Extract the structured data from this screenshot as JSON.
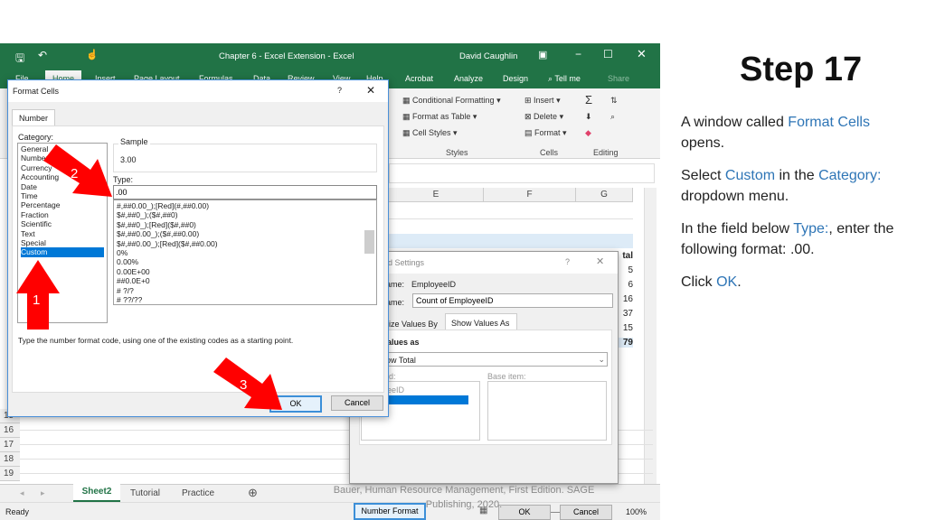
{
  "slide": {
    "title": "Step 17",
    "p1": {
      "a": "A window called ",
      "b": "Format Cells",
      "c": " opens."
    },
    "p2": {
      "a": "Select ",
      "b": "Custom",
      "c": " in the ",
      "d": "Category:",
      "e": " dropdown menu."
    },
    "p3": {
      "a": "In the field below ",
      "b": "Type:",
      "c": ", enter the following format: .00."
    },
    "p4": {
      "a": "Click ",
      "b": "OK",
      "c": "."
    },
    "citation": "Bauer, Human Resource Management, First Edition. SAGE Publishing, 2020.",
    "accent": "#2e75b6"
  },
  "excel": {
    "window_title": "Chapter 6 - Excel Extension  -  Excel",
    "user": "David Caughlin",
    "brand_color": "#217346",
    "tabs": [
      "File",
      "Home",
      "Insert",
      "Page Layout",
      "Formulas",
      "Data",
      "Review",
      "View",
      "Help",
      "Acrobat",
      "Analyze",
      "Design",
      "Tell me",
      "Share"
    ],
    "ribbon": {
      "conditional": "Conditional Formatting",
      "format_table": "Format as Table",
      "cell_styles": "Cell Styles",
      "styles": "Styles",
      "insert": "Insert",
      "delete": "Delete",
      "format": "Format",
      "cells": "Cells",
      "editing": "Editing"
    },
    "columns": [
      "E",
      "F",
      "G"
    ],
    "rows": [
      "15",
      "16",
      "17",
      "18",
      "19"
    ],
    "pivot_values": [
      "tal",
      "5",
      "6",
      "16",
      "37",
      "15",
      "79"
    ],
    "sheets": [
      "Sheet2",
      "Tutorial",
      "Practice"
    ],
    "status": "Ready",
    "zoom": "100%"
  },
  "format_cells": {
    "title": "Format Cells",
    "help": "?",
    "tab": "Number",
    "category_label": "Category:",
    "categories": [
      "General",
      "Number",
      "Currency",
      "Accounting",
      "Date",
      "Time",
      "Percentage",
      "Fraction",
      "Scientific",
      "Text",
      "Special",
      "Custom"
    ],
    "selected_category": "Custom",
    "sample_label": "Sample",
    "sample_value": "3.00",
    "type_label": "Type:",
    "type_value": ".00",
    "type_list": [
      "#,##0.00_);[Red](#,##0.00)",
      "$#,##0_);($#,##0)",
      "$#,##0_);[Red]($#,##0)",
      "$#,##0.00_);($#,##0.00)",
      "$#,##0.00_);[Red]($#,##0.00)",
      "0%",
      "0.00%",
      "0.00E+00",
      "##0.0E+0",
      "# ?/?",
      "# ??/??"
    ],
    "hint": "Type the number format code, using one of the existing codes as a starting point.",
    "ok": "OK",
    "cancel": "Cancel"
  },
  "field_settings": {
    "title": "ld Settings",
    "help": "?",
    "source_label": "ame:",
    "source_value": "EmployeeID",
    "custom_label": "ame:",
    "custom_value": "Count of EmployeeID",
    "tab1": "rize Values By",
    "tab2": "Show Values As",
    "values_as": "alues as",
    "dropdown": "ow Total",
    "base_field": "ld:",
    "base_field_item": "eeID",
    "base_item": "Base item:",
    "number_format": "Number Format",
    "ok": "OK",
    "cancel": "Cancel"
  },
  "annotations": [
    "1",
    "2",
    "3"
  ],
  "annotation_color": "#ff0000"
}
